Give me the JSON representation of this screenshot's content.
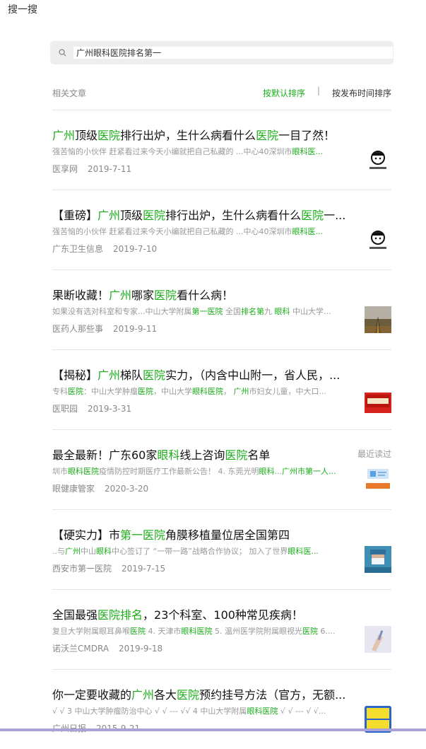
{
  "header": {
    "title": "搜一搜"
  },
  "search": {
    "value": "广州眼科医院排名第一"
  },
  "section": {
    "label": "相关文章",
    "sort_default": "按默认排序",
    "separator": "|",
    "sort_time": "按发布时间排序"
  },
  "accent_color": "#1aad19",
  "results": [
    {
      "title": [
        {
          "t": "广州",
          "h": true
        },
        {
          "t": "顶级",
          "h": false
        },
        {
          "t": "医院",
          "h": true
        },
        {
          "t": "排行出炉，生什么病看什么",
          "h": false
        },
        {
          "t": "医院",
          "h": true
        },
        {
          "t": "一目了然！",
          "h": false
        }
      ],
      "snippet": [
        {
          "t": "强苦恼的小伙伴 赶紧看过来今天小编就把自己私藏的 ...中心40深圳市",
          "h": false
        },
        {
          "t": "眼科医...",
          "h": true
        }
      ],
      "source": "医享网",
      "date": "2019-7-11",
      "thumb": "doctor-cartoon"
    },
    {
      "title": [
        {
          "t": "【重磅】",
          "h": false
        },
        {
          "t": "广州",
          "h": true
        },
        {
          "t": "顶级",
          "h": false
        },
        {
          "t": "医院",
          "h": true
        },
        {
          "t": "排行出炉，生什么病看什么",
          "h": false
        },
        {
          "t": "医院",
          "h": true
        },
        {
          "t": "一...",
          "h": false
        }
      ],
      "snippet": [
        {
          "t": "强苦恼的小伙伴 赶紧看过来今天小编就把自己私藏的 ...中心40深圳市",
          "h": false
        },
        {
          "t": "眼科医...",
          "h": true
        }
      ],
      "source": "广东卫生信息",
      "date": "2019-7-10",
      "thumb": "doctor-cartoon"
    },
    {
      "title": [
        {
          "t": "果断收藏！",
          "h": false
        },
        {
          "t": "广州",
          "h": true
        },
        {
          "t": "哪家",
          "h": false
        },
        {
          "t": "医院",
          "h": true
        },
        {
          "t": "看什么病！",
          "h": false
        }
      ],
      "snippet": [
        {
          "t": "如果没有选对科室和专家...中山大学附属",
          "h": false
        },
        {
          "t": "第一医院",
          "h": true
        },
        {
          "t": " 全国",
          "h": false
        },
        {
          "t": "排名第",
          "h": true
        },
        {
          "t": "九 ",
          "h": false
        },
        {
          "t": "眼科",
          "h": true
        },
        {
          "t": " 中山大学...",
          "h": false
        }
      ],
      "source": "医药人那些事",
      "date": "2019-9-11",
      "thumb": "road-photo"
    },
    {
      "title": [
        {
          "t": "【揭秘】",
          "h": false
        },
        {
          "t": "广州",
          "h": true
        },
        {
          "t": "梯队",
          "h": false
        },
        {
          "t": "医院",
          "h": true
        },
        {
          "t": "实力，（内含中山附一，省人民，...",
          "h": false
        }
      ],
      "snippet": [
        {
          "t": "专科",
          "h": false
        },
        {
          "t": "医院",
          "h": true
        },
        {
          "t": "：中山大学肿瘤",
          "h": false
        },
        {
          "t": "医院",
          "h": true
        },
        {
          "t": "，中山大学",
          "h": false
        },
        {
          "t": "眼科医院",
          "h": true
        },
        {
          "t": "， ",
          "h": false
        },
        {
          "t": "广州",
          "h": true
        },
        {
          "t": "市妇女儿童，中大口...",
          "h": false
        }
      ],
      "source": "医职园",
      "date": "2019-3-31",
      "thumb": "red-banner"
    },
    {
      "title": [
        {
          "t": "最全最新！广东60家",
          "h": false
        },
        {
          "t": "眼科",
          "h": true
        },
        {
          "t": "线上咨询",
          "h": false
        },
        {
          "t": "医院",
          "h": true
        },
        {
          "t": "名单",
          "h": false
        }
      ],
      "snippet": [
        {
          "t": "圳市",
          "h": false
        },
        {
          "t": "眼科医院",
          "h": true
        },
        {
          "t": "疫情防控时期医疗工作最新公告！ 4. 东莞光明",
          "h": false
        },
        {
          "t": "眼科",
          "h": true
        },
        {
          "t": "...",
          "h": false
        },
        {
          "t": "广州市第一人...",
          "h": true
        }
      ],
      "source": "眼健康管家",
      "date": "2020-3-20",
      "thumb": "info-card",
      "badge": "最近读过"
    },
    {
      "title": [
        {
          "t": "【硬实力】市",
          "h": false
        },
        {
          "t": "第一医院",
          "h": true
        },
        {
          "t": "角膜移植量位居全国第四",
          "h": false
        }
      ],
      "snippet": [
        {
          "t": "..与",
          "h": false
        },
        {
          "t": "广州",
          "h": true
        },
        {
          "t": "中山",
          "h": false
        },
        {
          "t": "眼科",
          "h": true
        },
        {
          "t": "中心签订了 “一带一路”战略合作协议； 加入了世界",
          "h": false
        },
        {
          "t": "眼科医...",
          "h": true
        }
      ],
      "source": "西安市第一医院",
      "date": "2019-7-15",
      "thumb": "surgeon-photo"
    },
    {
      "title": [
        {
          "t": "全国最强",
          "h": false
        },
        {
          "t": "医院排名",
          "h": true
        },
        {
          "t": "，23个科室、100种常见疾病！",
          "h": false
        }
      ],
      "snippet": [
        {
          "t": "复旦大学附属眼耳鼻喉",
          "h": false
        },
        {
          "t": "医院",
          "h": true
        },
        {
          "t": " 4. 天津市",
          "h": false
        },
        {
          "t": "眼科医院",
          "h": true
        },
        {
          "t": " 5. 温州医学院附属眼视光",
          "h": false
        },
        {
          "t": "医院",
          "h": true
        },
        {
          "t": " 6....",
          "h": false
        }
      ],
      "source": "诺沃兰CMDRA",
      "date": "2019-9-18",
      "thumb": "hand-photo"
    },
    {
      "title": [
        {
          "t": "你一定要收藏的",
          "h": false
        },
        {
          "t": "广州",
          "h": true
        },
        {
          "t": "各大",
          "h": false
        },
        {
          "t": "医院",
          "h": true
        },
        {
          "t": "预约挂号方法（官方，无额...",
          "h": false
        }
      ],
      "snippet": [
        {
          "t": "√ √ 3 中山大学肿瘤防治中心 √ √ --- √√ 4 中山大学附属",
          "h": false
        },
        {
          "t": "眼科医院",
          "h": true
        },
        {
          "t": " √ √ --- √ √...",
          "h": false
        }
      ],
      "source": "广州日报",
      "date": "2015-9-21",
      "thumb": "appointment-icon"
    }
  ]
}
